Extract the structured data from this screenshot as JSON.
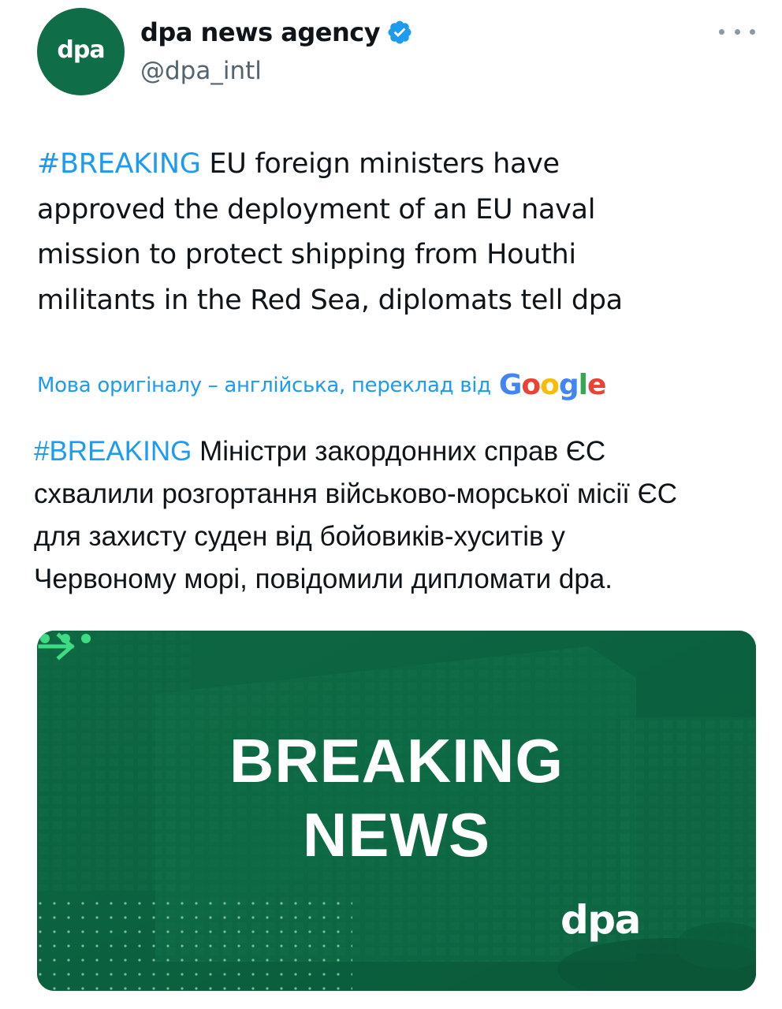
{
  "author": {
    "avatar_text": "dpa",
    "display_name": "dpa news agency",
    "handle": "@dpa_intl",
    "verified": true
  },
  "tweet": {
    "hashtag": "#BREAKING",
    "text_lines": [
      "EU foreign ministers have",
      "approved the deployment of an EU naval",
      "mission to protect shipping from Houthi",
      "militants in the Red Sea, diplomats tell dpa"
    ]
  },
  "translation": {
    "label": "Мова оригіналу – англійська, переклад від",
    "provider": "Google",
    "hashtag": "#BREAKING",
    "text_lines": [
      "Міністри закордонних справ ЄС",
      "схвалили розгортання військово-морської місії ЄС",
      "для захисту суден від бойовиків-хуситів у",
      "Червоному морі, повідомили дипломати dpa."
    ]
  },
  "media": {
    "headline_line1": "BREAKING",
    "headline_line2": "NEWS",
    "brand": "dpa"
  },
  "colors": {
    "accent": "#1d9bf0",
    "brand_green": "#0f6d48",
    "card_green": "#0b5c3b",
    "arrow_green": "#3ddc84"
  },
  "icons": {
    "verified": "verified-badge-icon",
    "more": "more-options-icon",
    "arrow": "arrow-right-icon"
  }
}
